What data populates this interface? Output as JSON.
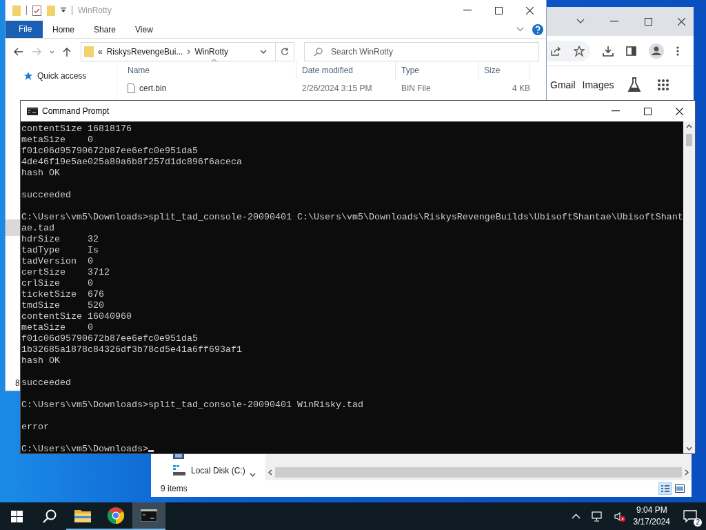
{
  "explorer": {
    "title": "WinRotty",
    "ribbon": [
      {
        "label": "File",
        "kind": "file"
      },
      {
        "label": "Home",
        "kind": "tab"
      },
      {
        "label": "Share",
        "kind": "tab"
      },
      {
        "label": "View",
        "kind": "tab"
      }
    ],
    "address": {
      "overflow": "«",
      "crumbs": [
        "RiskysRevengeBui...",
        "WinRotty"
      ]
    },
    "search": {
      "placeholder": "Search WinRotty"
    },
    "columns": [
      "Name",
      "Date modified",
      "Type",
      "Size"
    ],
    "nav": [
      {
        "label": "Quick access"
      }
    ],
    "rows": [
      {
        "name": "cert.bin",
        "date": "2/26/2024 3:15 PM",
        "type": "BIN File",
        "size": "4 KB"
      }
    ],
    "status": "8"
  },
  "browser": {
    "links": [
      "Gmail",
      "Images"
    ]
  },
  "command_prompt": {
    "title": "Command Prompt",
    "blocks": [
      [
        "contentSize 16818176",
        "metaSize    0",
        "f01c06d95790672b87ee6efc0e951da5",
        "4de46f19e5ae025a80a6b8f257d1dc896f6aceca",
        "hash OK"
      ],
      [
        "succeeded"
      ],
      [
        "C:\\Users\\vm5\\Downloads>split_tad_console-20090401 C:\\Users\\vm5\\Downloads\\RiskysRevengeBuilds\\UbisoftShantae\\UbisoftShant",
        "ae.tad",
        "hdrSize     32",
        "tadType     Is",
        "tadVersion  0",
        "certSize    3712",
        "crlSize     0",
        "ticketSize  676",
        "tmdSize     520",
        "contentSize 16040960",
        "metaSize    0",
        "f01c06d95790672b87ee6efc0e951da5",
        "1b32685a1878c84326df3b78cd5e41a6ff693af1",
        "hash OK"
      ],
      [
        "succeeded"
      ],
      [
        "C:\\Users\\vm5\\Downloads>split_tad_console-20090401 WinRisky.tad"
      ],
      [
        "error"
      ],
      [
        "C:\\Users\\vm5\\Downloads>"
      ]
    ]
  },
  "explorer_2": {
    "nav": [
      {
        "kind": "videos"
      },
      {
        "label": "Local Disk (C:)",
        "kind": "disk"
      }
    ],
    "status": "9 items"
  },
  "taskbar": {
    "apps": [
      {
        "kind": "start",
        "running": false,
        "active": false
      },
      {
        "kind": "search",
        "running": false,
        "active": false
      },
      {
        "kind": "folder",
        "running": true,
        "active": false
      },
      {
        "kind": "browser",
        "running": true,
        "active": false
      },
      {
        "kind": "console",
        "running": true,
        "active": true
      }
    ],
    "volume_muted": true,
    "time": "9:04 PM",
    "date": "3/17/2024",
    "notifications": "2"
  }
}
